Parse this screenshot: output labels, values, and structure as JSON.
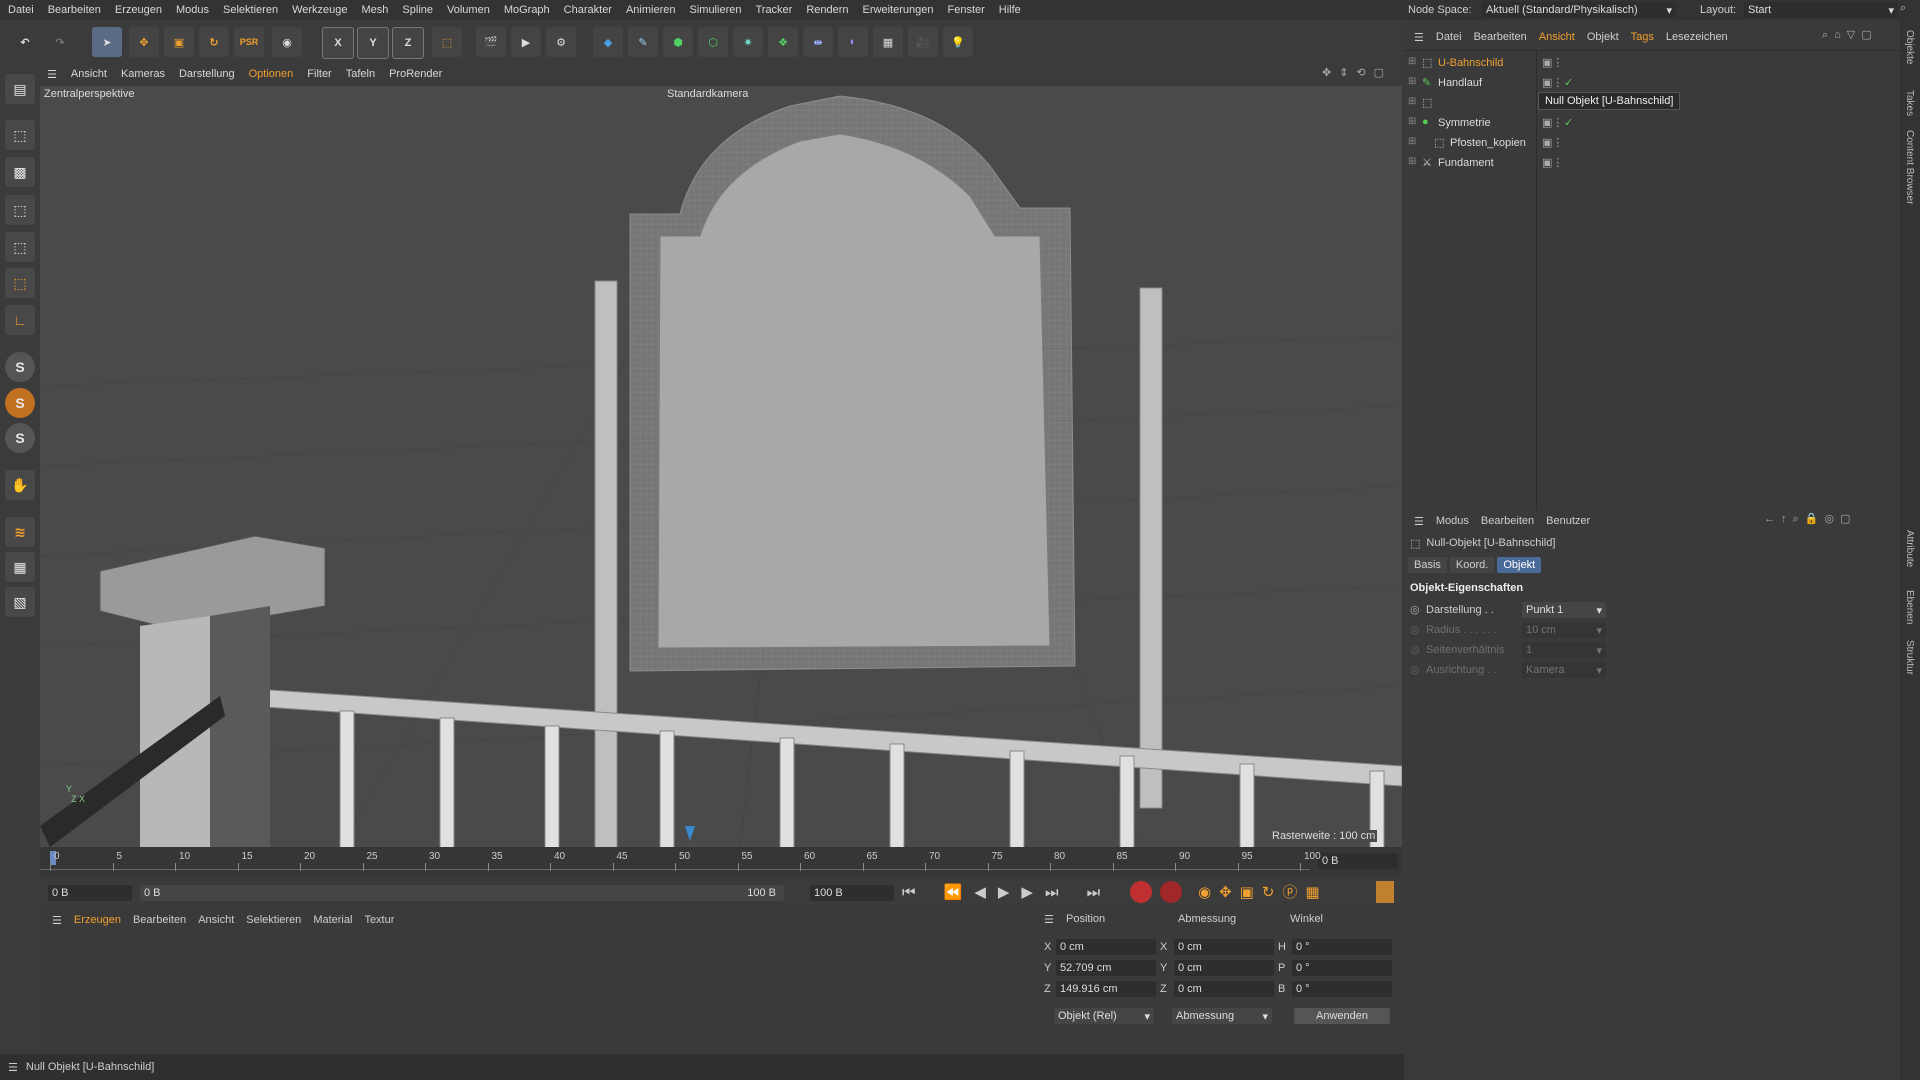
{
  "menubar": {
    "items": [
      "Datei",
      "Bearbeiten",
      "Erzeugen",
      "Modus",
      "Selektieren",
      "Werkzeuge",
      "Mesh",
      "Spline",
      "Volumen",
      "MoGraph",
      "Charakter",
      "Animieren",
      "Simulieren",
      "Tracker",
      "Rendern",
      "Erweiterungen",
      "Fenster",
      "Hilfe"
    ],
    "node_space_label": "Node Space:",
    "node_space_value": "Aktuell (Standard/Physikalisch)",
    "layout_label": "Layout:",
    "layout_value": "Start"
  },
  "toolbar": {
    "axis_x": "X",
    "axis_y": "Y",
    "axis_z": "Z"
  },
  "lefttools": {
    "s1": "S",
    "s2": "S",
    "s3": "S"
  },
  "viewport": {
    "menu": [
      "Ansicht",
      "Kameras",
      "Darstellung",
      "Optionen",
      "Filter",
      "Tafeln",
      "ProRender"
    ],
    "perspective_label": "Zentralperspektive",
    "camera_label": "Standardkamera",
    "grid_label": "Rasterweite : 100 cm"
  },
  "timeline": {
    "ticks": [
      "0",
      "5",
      "10",
      "15",
      "20",
      "25",
      "30",
      "35",
      "40",
      "45",
      "50",
      "55",
      "60",
      "65",
      "70",
      "75",
      "80",
      "85",
      "90",
      "95",
      "100"
    ],
    "current_frame": "0 B"
  },
  "transport": {
    "start_field": "0 B",
    "range_start": "0 B",
    "range_end": "100 B",
    "end_field": "100 B"
  },
  "material_panel": {
    "menu": [
      "Erzeugen",
      "Bearbeiten",
      "Ansicht",
      "Selektieren",
      "Material",
      "Textur"
    ]
  },
  "coord_panel": {
    "headers": {
      "position": "Position",
      "size": "Abmessung",
      "rotation": "Winkel"
    },
    "rows": [
      {
        "axis": "X",
        "pos": "0 cm",
        "saxis": "X",
        "size": "0 cm",
        "raxis": "H",
        "rot": "0 °"
      },
      {
        "axis": "Y",
        "pos": "52.709 cm",
        "saxis": "Y",
        "size": "0 cm",
        "raxis": "P",
        "rot": "0 °"
      },
      {
        "axis": "Z",
        "pos": "149.916 cm",
        "saxis": "Z",
        "size": "0 cm",
        "raxis": "B",
        "rot": "0 °"
      }
    ],
    "mode_select": "Objekt (Rel)",
    "size_select": "Abmessung",
    "apply_button": "Anwenden"
  },
  "status_bar": {
    "text": "Null Objekt [U-Bahnschild]"
  },
  "object_manager": {
    "menu": [
      "Datei",
      "Bearbeiten",
      "Ansicht",
      "Objekt",
      "Tags",
      "Lesezeichen"
    ],
    "objects": [
      {
        "name": "U-Bahnschild",
        "indent": 0,
        "selected": true
      },
      {
        "name": "Handlauf",
        "indent": 0,
        "selected": false
      },
      {
        "name": "",
        "indent": 0,
        "selected": false
      },
      {
        "name": "Symmetrie",
        "indent": 0,
        "selected": false
      },
      {
        "name": "Pfosten_kopien",
        "indent": 1,
        "selected": false
      },
      {
        "name": "Fundament",
        "indent": 0,
        "selected": false
      }
    ],
    "tooltip": "Null Objekt [U-Bahnschild]"
  },
  "attribute_manager": {
    "menu": [
      "Modus",
      "Bearbeiten",
      "Benutzer"
    ],
    "object_title": "Null-Objekt [U-Bahnschild]",
    "tabs": [
      "Basis",
      "Koord.",
      "Objekt"
    ],
    "active_tab": "Objekt",
    "section_title": "Objekt-Eigenschaften",
    "props": [
      {
        "label": "Darstellung . .",
        "value": "Punkt 1",
        "enabled": true
      },
      {
        "label": "Radius . . . . . .",
        "value": "10 cm",
        "enabled": false
      },
      {
        "label": "Seitenverhältnis",
        "value": "1",
        "enabled": false
      },
      {
        "label": "Ausrichtung . .",
        "value": "Kamera",
        "enabled": false
      }
    ]
  },
  "side_tabs": {
    "objects": "Objekte",
    "takes": "Takes",
    "content": "Content Browser",
    "attrs": "Attribute",
    "layers": "Ebenen",
    "struct": "Struktur"
  },
  "colors": {
    "accent": "#f0a030",
    "selected_tab": "#4a6a9a",
    "viewport_bg": "#4a4a4a"
  }
}
